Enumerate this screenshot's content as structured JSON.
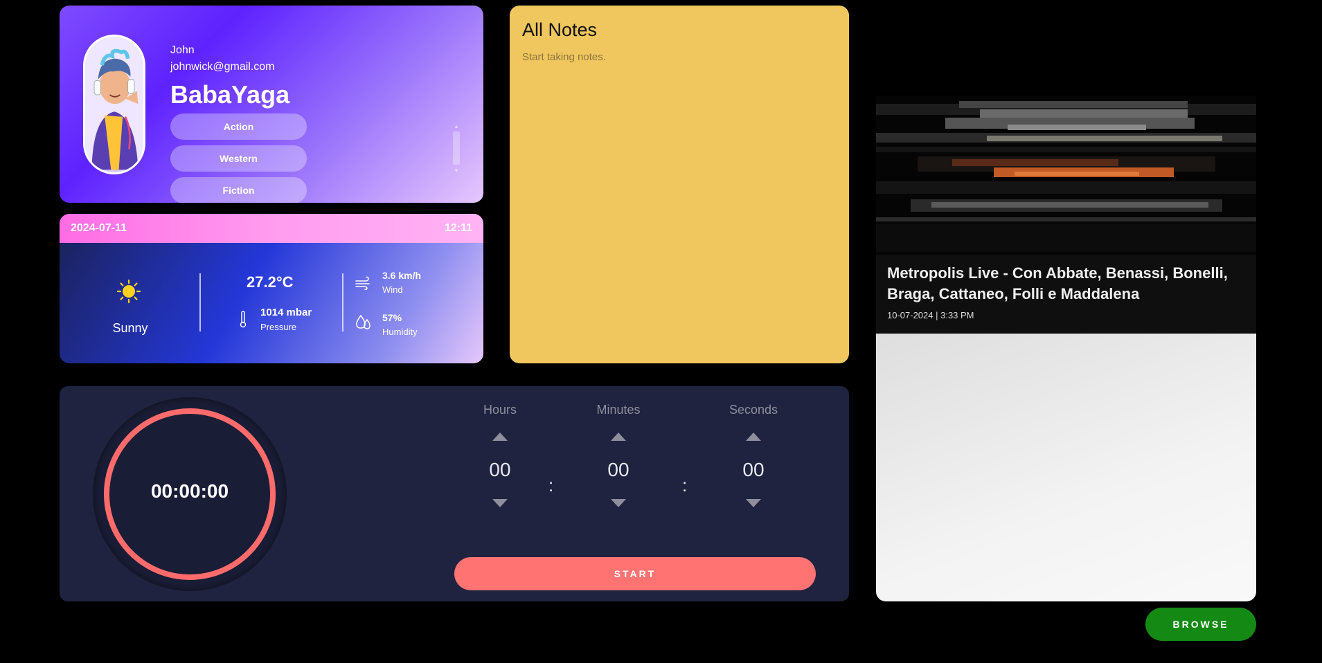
{
  "profile": {
    "name": "John",
    "email": "johnwick@gmail.com",
    "nickname": "BabaYaga",
    "genres": [
      "Action",
      "Western",
      "Fiction"
    ],
    "avatar_icon": "avatar-illustration"
  },
  "weather": {
    "date": "2024-07-11",
    "time": "12:11",
    "condition": "Sunny",
    "condition_icon": "sun-icon",
    "temperature": "27.2°C",
    "pressure_value": "1014 mbar",
    "pressure_label": "Pressure",
    "wind_value": "3.6 km/h",
    "wind_label": "Wind",
    "humidity_value": "57%",
    "humidity_label": "Humidity"
  },
  "notes": {
    "title": "All Notes",
    "placeholder": "Start taking notes.",
    "background": "#f0c75e"
  },
  "timer": {
    "display": "00:00:00",
    "hours_label": "Hours",
    "minutes_label": "Minutes",
    "seconds_label": "Seconds",
    "hours": "00",
    "minutes": "00",
    "seconds": "00",
    "separator": ":",
    "start_label": "START",
    "accent": "#ff7373"
  },
  "news": {
    "title": "Metropolis Live - Con Abbate, Benassi, Bonelli, Braga, Cattaneo, Folli e Maddalena",
    "date": "10-07-2024 | 3:33 PM",
    "browse_label": "BROWSE",
    "browse_color": "#148a14"
  }
}
